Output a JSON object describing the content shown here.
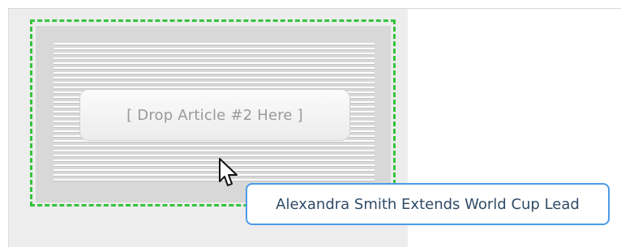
{
  "drop_target": {
    "label": "[ Drop Article #2 Here ]"
  },
  "drag_tooltip": {
    "text": "Alexandra Smith Extends World Cup Lead"
  },
  "cursor": {
    "icon": "arrow-pointer-icon"
  },
  "colors": {
    "drop_outline": "#35c33d",
    "tooltip_border": "#4a9be8",
    "panel_background": "#ededed"
  }
}
